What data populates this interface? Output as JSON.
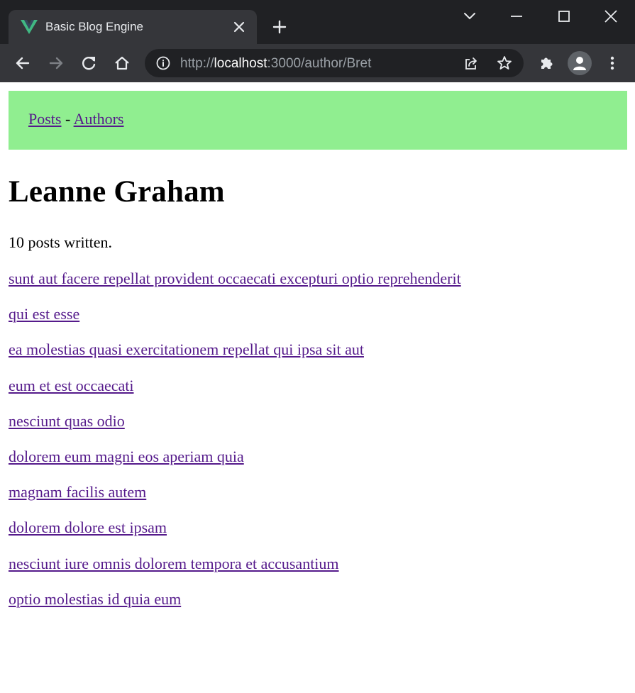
{
  "browser": {
    "tab_title": "Basic Blog Engine",
    "url_scheme": "http://",
    "url_host": "localhost",
    "url_path": ":3000/author/Bret",
    "accent_color": "#41b883"
  },
  "nav": {
    "posts_label": "Posts",
    "separator": " - ",
    "authors_label": "Authors",
    "background": "#90ee90"
  },
  "author": {
    "name": "Leanne Graham",
    "post_count_text": "10 posts written."
  },
  "posts": [
    "sunt aut facere repellat provident occaecati excepturi optio reprehenderit",
    "qui est esse",
    "ea molestias quasi exercitationem repellat qui ipsa sit aut",
    "eum et est occaecati",
    "nesciunt quas odio",
    "dolorem eum magni eos aperiam quia",
    "magnam facilis autem",
    "dolorem dolore est ipsam",
    "nesciunt iure omnis dolorem tempora et accusantium",
    "optio molestias id quia eum"
  ]
}
